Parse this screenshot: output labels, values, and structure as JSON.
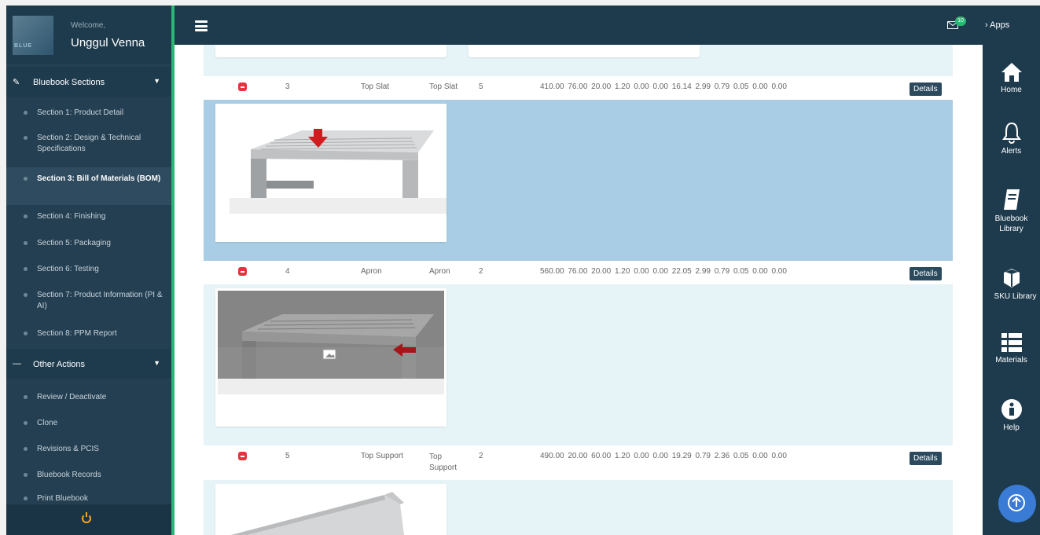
{
  "user": {
    "welcome": "Welcome,",
    "name": "Unggul Venna",
    "logo_text": "BLUE"
  },
  "topbar": {
    "mail_count": "10",
    "apps_label": "Apps"
  },
  "sidebar": {
    "section_header": "Bluebook Sections",
    "sections": [
      "Section 1: Product Detail",
      "Section 2: Design & Technical Specifications",
      "Section 3: Bill of Materials (BOM)",
      "Section 4: Finishing",
      "Section 5: Packaging",
      "Section 6: Testing",
      "Section 7: Product Information (PI & AI)",
      "Section 8: PPM Report"
    ],
    "other_header": "Other Actions",
    "actions": [
      "Review / Deactivate",
      "Clone",
      "Revisions & PCIS",
      "Bluebook Records",
      "Print Bluebook"
    ]
  },
  "rail": {
    "items": [
      {
        "label": "Home",
        "icon": "home-icon"
      },
      {
        "label": "Alerts",
        "icon": "bell-icon"
      },
      {
        "label": "Bluebook Library",
        "icon": "book-icon"
      },
      {
        "label": "SKU Library",
        "icon": "cube-icon"
      },
      {
        "label": "Materials",
        "icon": "list-icon"
      },
      {
        "label": "Help",
        "icon": "info-icon"
      }
    ]
  },
  "bom_rows": [
    {
      "no": "3",
      "part": "Top Slat",
      "material": "Top Slat",
      "qty": "5",
      "values": "410.00 76.00 20.00 1.20 0.00 0.00 16.14 2.99 0.79 0.05 0.00 0.00",
      "details": "Details"
    },
    {
      "no": "4",
      "part": "Apron",
      "material": "Apron",
      "qty": "2",
      "values": "560.00 76.00 20.00 1.20 0.00 0.00 22.05 2.99 0.79 0.05 0.00 0.00",
      "details": "Details"
    },
    {
      "no": "5",
      "part": "Top Support",
      "material": "Top Support",
      "qty": "2",
      "values": "490.00 20.00 60.00 1.20 0.00 0.00 19.29 0.79 2.36 0.05 0.00 0.00",
      "details": "Details"
    }
  ]
}
